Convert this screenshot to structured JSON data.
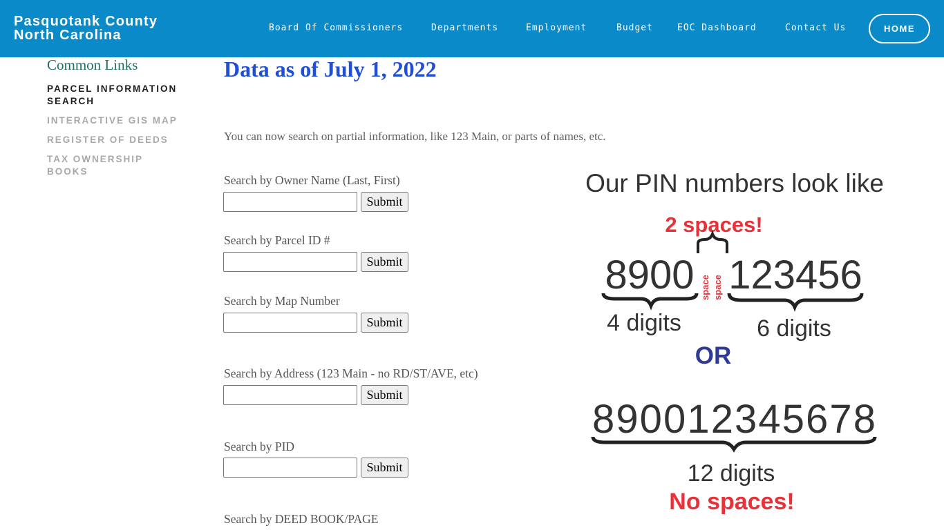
{
  "header": {
    "brand_line1": "Pasquotank County",
    "brand_line2": "North Carolina",
    "nav": [
      {
        "label": "Board Of Commissioners"
      },
      {
        "label": "Departments"
      },
      {
        "label": "Employment"
      },
      {
        "label": "Budget"
      },
      {
        "label": "EOC Dashboard"
      },
      {
        "label": "Contact Us"
      }
    ],
    "home_label": "HOME",
    "bg_color": "#0b8ac9"
  },
  "sidebar": {
    "title": "Common Links",
    "links": [
      {
        "label": "PARCEL INFORMATION SEARCH",
        "active": true
      },
      {
        "label": "INTERACTIVE GIS MAP",
        "active": false
      },
      {
        "label": "REGISTER OF DEEDS",
        "active": false
      },
      {
        "label": "TAX OWNERSHIP BOOKS",
        "active": false
      }
    ]
  },
  "main": {
    "title": "Data as of July 1, 2022",
    "intro": "You can now search on partial information, like 123 Main, or parts of names, etc.",
    "searches": [
      {
        "label": "Search by Owner Name (Last, First)",
        "value": "",
        "button": "Submit"
      },
      {
        "label": "Search by Parcel ID #",
        "value": "",
        "button": "Submit"
      },
      {
        "label": "Search by Map Number",
        "value": "",
        "button": "Submit"
      },
      {
        "label": "Search by Address (123 Main - no RD/ST/AVE, etc)",
        "value": "",
        "button": "Submit"
      },
      {
        "label": "Search by PID",
        "value": "",
        "button": "Submit"
      },
      {
        "label": "Search by DEED BOOK/PAGE"
      }
    ]
  },
  "pin_graphic": {
    "heading": "Our PIN numbers look like",
    "two_spaces": "2 spaces!",
    "part1": "8900",
    "space_word": "space",
    "part2": "123456",
    "part1_caption": "4 digits",
    "part2_caption": "6 digits",
    "or": "OR",
    "full": "890012345678",
    "full_caption": "12 digits",
    "no_spaces": "No spaces!",
    "red": "#e8323a",
    "blue": "#2e3a96",
    "dark": "#333333"
  }
}
